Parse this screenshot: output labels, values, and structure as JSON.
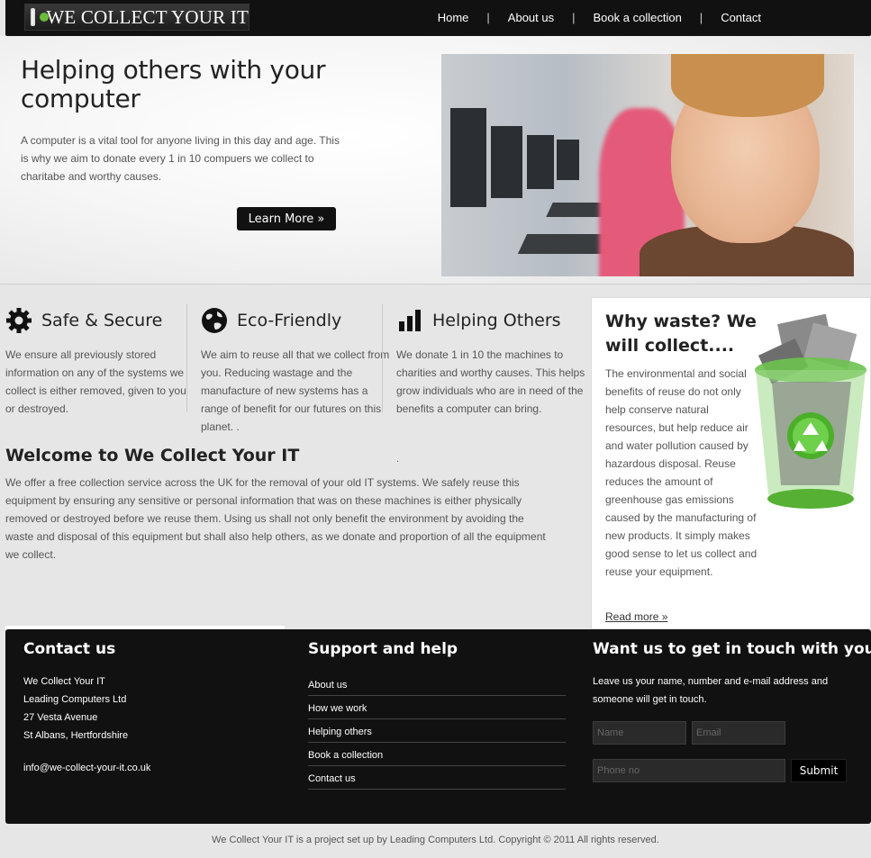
{
  "header": {
    "logo_text": "WE COLLECT YOUR IT",
    "nav": [
      {
        "label": "Home"
      },
      {
        "label": "About us"
      },
      {
        "label": "Book a collection"
      },
      {
        "label": "Contact"
      }
    ],
    "separator": "|"
  },
  "hero": {
    "title": "Helping others with your computer",
    "text": "A computer is a vital tool for anyone living in this day and age. This is why we aim to donate every 1 in 10 compuers we collect to charitabe and worthy causes.",
    "button_label": "Learn More »"
  },
  "features": [
    {
      "icon": "gear-icon",
      "title": "Safe & Secure",
      "text": "We ensure all previously stored information on any of the systems we collect is either removed, given to you or destroyed."
    },
    {
      "icon": "globe-icon",
      "title": "Eco-Friendly",
      "text": "We aim to reuse all that we collect from you. Reducing wastage and the manufacture of new systems has a range of benefit for our futures on this planet. ."
    },
    {
      "icon": "bar-chart-icon",
      "title": "Helping Others",
      "text": "We donate 1 in 10 the machines to charities and worthy causes. This helps grow individuals who are in need of the benefits a computer can bring."
    }
  ],
  "stray_dot": ".",
  "welcome": {
    "title": "Welcome to We Collect Your IT",
    "text": "We offer a free collection service across the UK for the removal of your old IT systems. We safely reuse this equipment by ensuring any sensitive or personal information that was on these machines is either physically removed or destroyed before we reuse them. Using us shall not only benefit the environment by avoiding the waste and disposal of this equipment but shall also help others, as we donate and proportion of all the equipment we collect."
  },
  "why": {
    "title": "Why waste? We will collect....",
    "text": "The environmental and social benefits of reuse do not only help conserve natural resources, but help reduce air and water pollution caused by hazardous disposal. Reuse reduces the amount of greenhouse gas emissions caused by the manufacturing of new products. It simply makes good sense to let us collect and reuse your equipment.",
    "read_more": "Read more »"
  },
  "footer": {
    "contact": {
      "title": "Contact us",
      "lines": [
        "We Collect Your IT",
        "Leading Computers Ltd",
        "27 Vesta Avenue",
        "St Albans, Hertfordshire"
      ],
      "email": "info@we-collect-your-it.co.uk"
    },
    "support": {
      "title": "Support and help",
      "links": [
        "About us",
        "How we work",
        "Helping others",
        "Book a collection",
        "Contact us"
      ]
    },
    "touch": {
      "title": "Want us to get in touch with you",
      "text": "Leave us your name, number and e-mail address and someone will get in touch.",
      "name_placeholder": "Name",
      "email_placeholder": "Email",
      "phone_placeholder": "Phone no",
      "submit_label": "Submit"
    }
  },
  "copyright": "We Collect Your IT is a project set up by Leading Computers Ltd. Copyright © 2011 All rights reserved."
}
